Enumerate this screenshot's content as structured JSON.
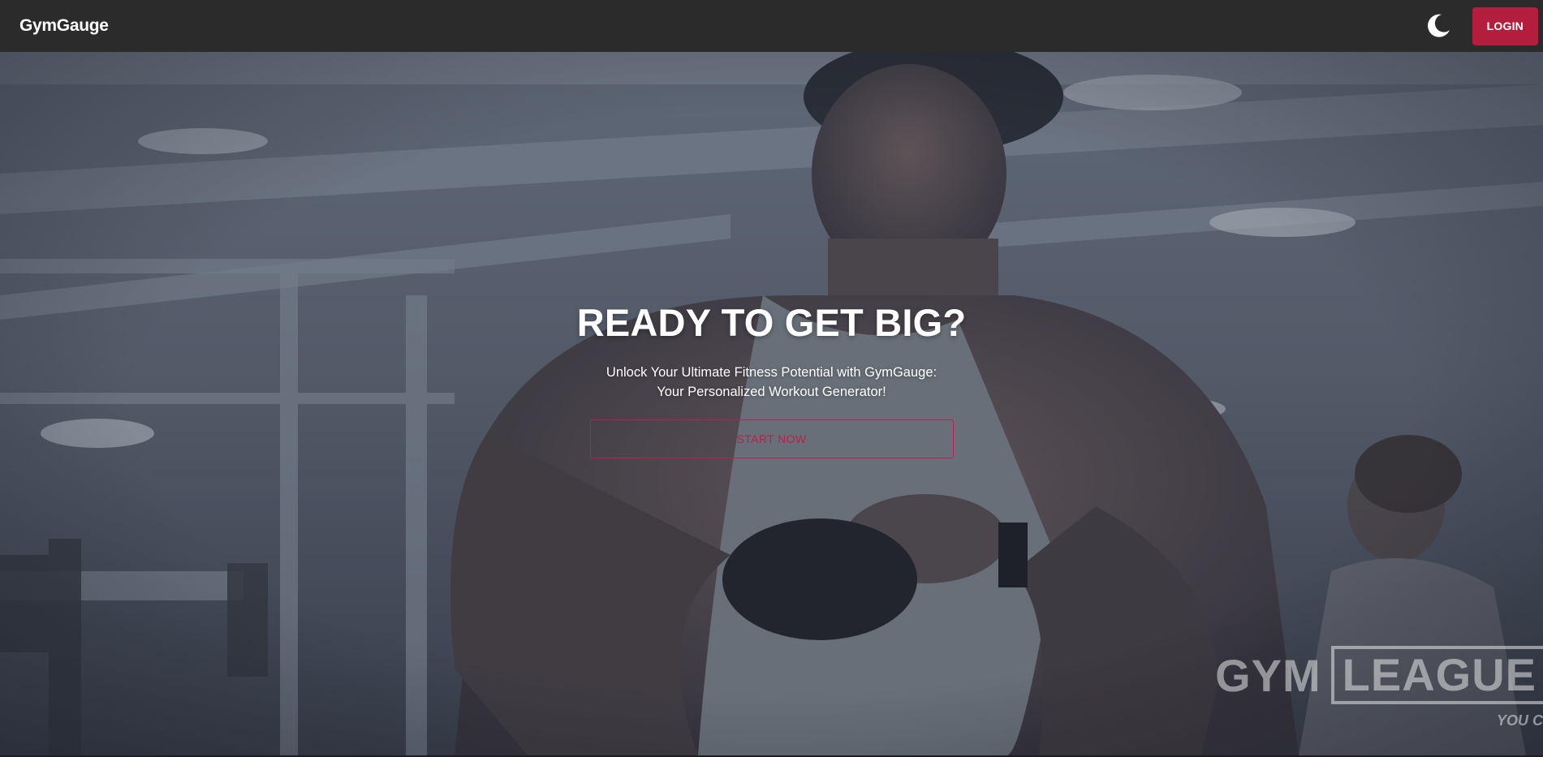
{
  "app": {
    "brand": "GymGauge"
  },
  "header": {
    "theme_toggle_icon": "moon-icon",
    "login_label": "LOGIN",
    "login_color": "#b31e3f"
  },
  "hero": {
    "title": "READY TO GET BIG?",
    "subtitle": "Unlock Your Ultimate Fitness Potential with GymGauge: Your Personalized Workout Generator!",
    "cta_label": "START NOW",
    "cta_color": "#b8214a",
    "watermark": {
      "part1": "GYM",
      "part2": "LEAGUE",
      "tagline": "YOU C"
    }
  }
}
